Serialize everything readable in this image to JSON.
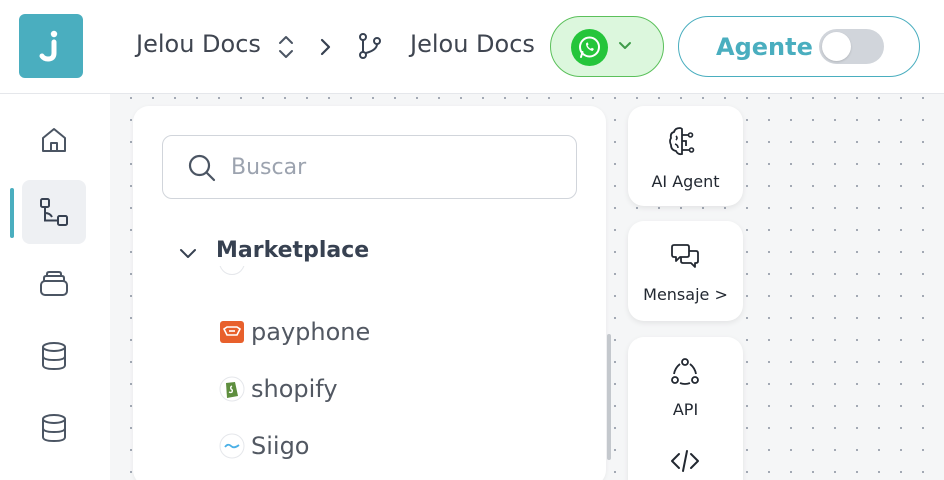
{
  "header": {
    "logo_letter": "j",
    "workspace_name": "Jelou Docs",
    "flow_name": "Jelou Docs",
    "agent_toggle_label": "Agente",
    "agent_toggle_on": false,
    "accent_color": "#4aaebf",
    "whatsapp_color": "#25c53b"
  },
  "sidebar": {
    "items": [
      {
        "icon": "home-icon",
        "active": false
      },
      {
        "icon": "flow-icon",
        "active": true
      },
      {
        "icon": "layers-icon",
        "active": false
      },
      {
        "icon": "database-icon",
        "active": false
      },
      {
        "icon": "database-icon",
        "active": false
      }
    ]
  },
  "panel": {
    "search_placeholder": "Buscar",
    "search_value": "",
    "section_title": "Marketplace",
    "items": [
      {
        "label": "payphone",
        "icon": "payphone-icon"
      },
      {
        "label": "shopify",
        "icon": "shopify-icon"
      },
      {
        "label": "Siigo",
        "icon": "siigo-icon"
      }
    ]
  },
  "nodes": [
    {
      "label": "AI Agent",
      "icon": "brain-icon"
    },
    {
      "label": "Mensaje >",
      "icon": "message-icon"
    },
    {
      "label": "API",
      "icon": "api-icon"
    }
  ]
}
